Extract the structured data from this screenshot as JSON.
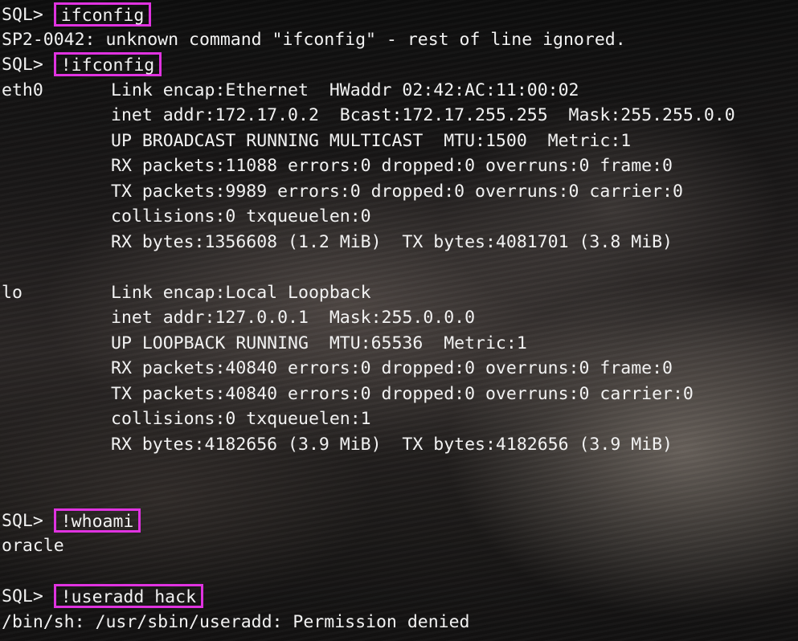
{
  "prompt": "SQL> ",
  "commands": {
    "c1": "ifconfig",
    "c2": "!ifconfig",
    "c3": "!whoami",
    "c4": "!useradd hack"
  },
  "outputs": {
    "sp2_error": "SP2-0042: unknown command \"ifconfig\" - rest of line ignored.",
    "whoami": "oracle",
    "useradd_error": "/bin/sh: /usr/sbin/useradd: Permission denied"
  },
  "interfaces": [
    {
      "name": "eth0",
      "lines": [
        "Link encap:Ethernet  HWaddr 02:42:AC:11:00:02",
        "inet addr:172.17.0.2  Bcast:172.17.255.255  Mask:255.255.0.0",
        "UP BROADCAST RUNNING MULTICAST  MTU:1500  Metric:1",
        "RX packets:11088 errors:0 dropped:0 overruns:0 frame:0",
        "TX packets:9989 errors:0 dropped:0 overruns:0 carrier:0",
        "collisions:0 txqueuelen:0",
        "RX bytes:1356608 (1.2 MiB)  TX bytes:4081701 (3.8 MiB)"
      ]
    },
    {
      "name": "lo",
      "lines": [
        "Link encap:Local Loopback",
        "inet addr:127.0.0.1  Mask:255.0.0.0",
        "UP LOOPBACK RUNNING  MTU:65536  Metric:1",
        "RX packets:40840 errors:0 dropped:0 overruns:0 frame:0",
        "TX packets:40840 errors:0 dropped:0 overruns:0 carrier:0",
        "collisions:0 txqueuelen:1",
        "RX bytes:4182656 (3.9 MiB)  TX bytes:4182656 (3.9 MiB)"
      ]
    }
  ]
}
